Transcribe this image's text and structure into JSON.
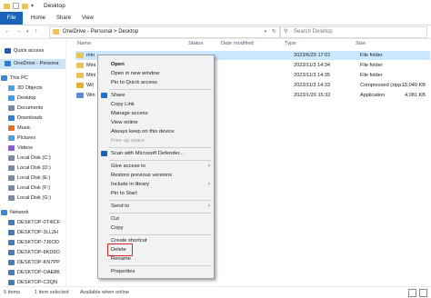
{
  "window": {
    "title": "Desktop"
  },
  "ribbon": {
    "tabs": [
      "File",
      "Home",
      "Share",
      "View"
    ]
  },
  "address": {
    "path": "OneDrive - Personal  >  Desktop",
    "search_placeholder": "Search Desktop"
  },
  "sidebar": {
    "items": [
      {
        "label": "Quick access",
        "color": "#1a63b8"
      },
      {
        "label": "OneDrive - Persona",
        "color": "#2b7cd3",
        "selected": true
      },
      {
        "label": "This PC",
        "color": "#3a8ad8"
      },
      {
        "label": "3D Objects",
        "color": "#4aa3e0"
      },
      {
        "label": "Desktop",
        "color": "#3b9de6"
      },
      {
        "label": "Documents",
        "color": "#7a8aa0"
      },
      {
        "label": "Downloads",
        "color": "#2d7fd0"
      },
      {
        "label": "Music",
        "color": "#e07020"
      },
      {
        "label": "Pictures",
        "color": "#4aa3e0"
      },
      {
        "label": "Videos",
        "color": "#8a5ad0"
      },
      {
        "label": "Local Disk (C:)",
        "color": "#7a8aa0"
      },
      {
        "label": "Local Disk (D:)",
        "color": "#7a8aa0"
      },
      {
        "label": "Local Disk (E:)",
        "color": "#7a8aa0"
      },
      {
        "label": "Local Disk (F:)",
        "color": "#7a8aa0"
      },
      {
        "label": "Local Disk (G:)",
        "color": "#7a8aa0"
      },
      {
        "label": "Network",
        "color": "#3a8ad8"
      },
      {
        "label": "DESKTOP-0T4ICF",
        "color": "#4a7ab0"
      },
      {
        "label": "DESKTOP-3LL2H",
        "color": "#4a7ab0"
      },
      {
        "label": "DESKTOP-7J6OD",
        "color": "#4a7ab0"
      },
      {
        "label": "DESKTOP-8KD9O",
        "color": "#4a7ab0"
      },
      {
        "label": "DESKTOP-KN7PP",
        "color": "#4a7ab0"
      },
      {
        "label": "DESKTOP-OAE8K",
        "color": "#4a7ab0"
      },
      {
        "label": "DESKTOP-C3QN",
        "color": "#4a7ab0"
      }
    ]
  },
  "columns": {
    "name": "Name",
    "status": "Status",
    "date": "Date modified",
    "type": "Type",
    "size": "Size"
  },
  "files": [
    {
      "name": "min",
      "date": "2023/6/29 17:01",
      "type": "File folder",
      "size": "",
      "selected": true,
      "color": "#e8c45a"
    },
    {
      "name": "Mini",
      "date": "2023/11/3 14:34",
      "type": "File folder",
      "size": "",
      "color": "#e8c45a"
    },
    {
      "name": "Mini",
      "date": "2023/11/3 14:35",
      "type": "File folder",
      "size": "",
      "color": "#e8c45a"
    },
    {
      "name": "Wil",
      "date": "2023/11/3 14:33",
      "type": "Compressed (zipp...",
      "size": "15,040 KB",
      "color": "#e0b030"
    },
    {
      "name": "Win",
      "date": "2023/1/20 15:32",
      "type": "Application",
      "size": "4,081 KB",
      "color": "#5a8ad0"
    }
  ],
  "context_menu": {
    "open": "Open",
    "open_new_window": "Open in new window",
    "pin_quick": "Pin to Quick access",
    "share": "Share",
    "copy_link": "Copy Link",
    "manage_access": "Manage access",
    "view_online": "View online",
    "always_keep": "Always keep on this device",
    "free_up": "Free up space",
    "scan": "Scan with Microsoft Defender...",
    "give_access": "Give access to",
    "restore_prev": "Restore previous versions",
    "include_library": "Include in library",
    "pin_start": "Pin to Start",
    "send_to": "Send to",
    "cut": "Cut",
    "copy": "Copy",
    "create_shortcut": "Create shortcut",
    "delete": "Delete",
    "rename": "Rename",
    "properties": "Properties"
  },
  "status": {
    "items": "5 items",
    "selected": "1 item selected",
    "availability": "Available when online"
  },
  "colors": {
    "accent": "#1a63b8",
    "selection": "#cce8ff",
    "highlight": "#d62020"
  }
}
